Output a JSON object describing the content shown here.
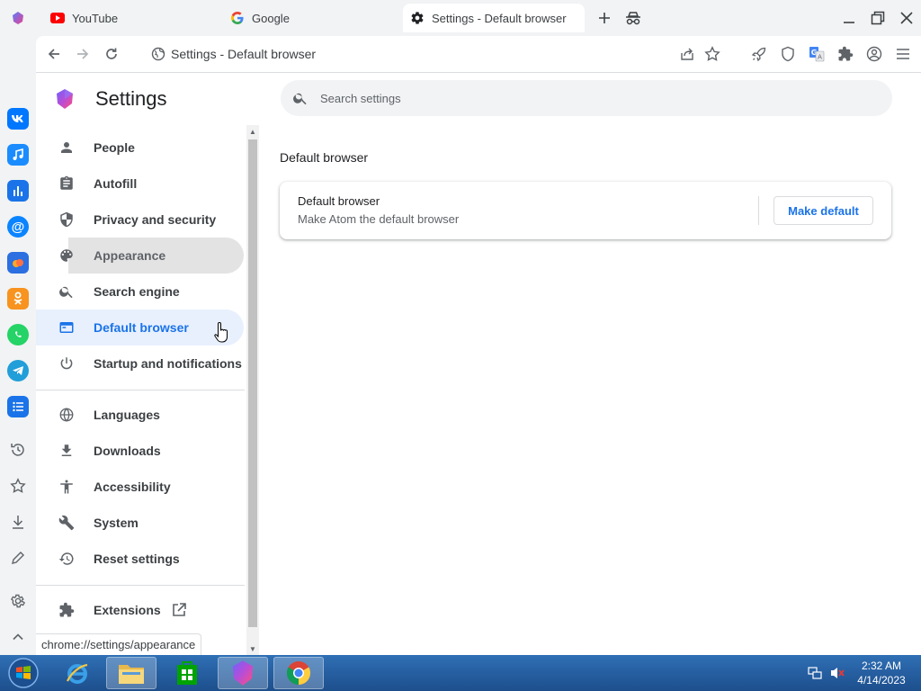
{
  "tabs": [
    {
      "label": "YouTube",
      "icon": "youtube-icon"
    },
    {
      "label": "Google",
      "icon": "google-icon"
    },
    {
      "label": "Settings - Default browser",
      "icon": "gear-icon",
      "active": true
    }
  ],
  "toolbar": {
    "omnibox_text": "Settings - Default browser"
  },
  "appbar": {
    "icons": [
      "vk-icon",
      "music-icon",
      "stats-icon",
      "mail-at-icon",
      "cloud-icon",
      "odnoklassniki-icon",
      "whatsapp-icon",
      "telegram-icon",
      "list-icon",
      "history-icon",
      "star-icon",
      "download-icon",
      "pen-icon",
      "settings-icon",
      "chevron-up-icon"
    ]
  },
  "sidebar": {
    "title": "Settings",
    "items": [
      {
        "label": "People",
        "icon": "person-icon"
      },
      {
        "label": "Autofill",
        "icon": "clipboard-icon"
      },
      {
        "label": "Privacy and security",
        "icon": "shield-icon"
      },
      {
        "label": "Appearance",
        "icon": "palette-icon",
        "state": "hover"
      },
      {
        "label": "Search engine",
        "icon": "search-icon"
      },
      {
        "label": "Default browser",
        "icon": "browser-window-icon",
        "state": "selected"
      },
      {
        "label": "Startup and notifications",
        "icon": "power-icon"
      },
      {
        "label": "Languages",
        "icon": "globe-icon"
      },
      {
        "label": "Downloads",
        "icon": "download-icon"
      },
      {
        "label": "Accessibility",
        "icon": "accessibility-icon"
      },
      {
        "label": "System",
        "icon": "wrench-icon"
      },
      {
        "label": "Reset settings",
        "icon": "restore-icon"
      },
      {
        "label": "Extensions",
        "icon": "puzzle-icon"
      }
    ],
    "status_url": "chrome://settings/appearance"
  },
  "main": {
    "search_placeholder": "Search settings",
    "section_title": "Default browser",
    "card": {
      "title": "Default browser",
      "subtitle": "Make Atom the default browser",
      "button_label": "Make default"
    }
  },
  "taskbar": {
    "time": "2:32 AM",
    "date": "4/14/2023"
  },
  "colors": {
    "accent": "#1a73e8",
    "selected_bg": "#e8f0fe",
    "taskbar": "#245ea3"
  }
}
